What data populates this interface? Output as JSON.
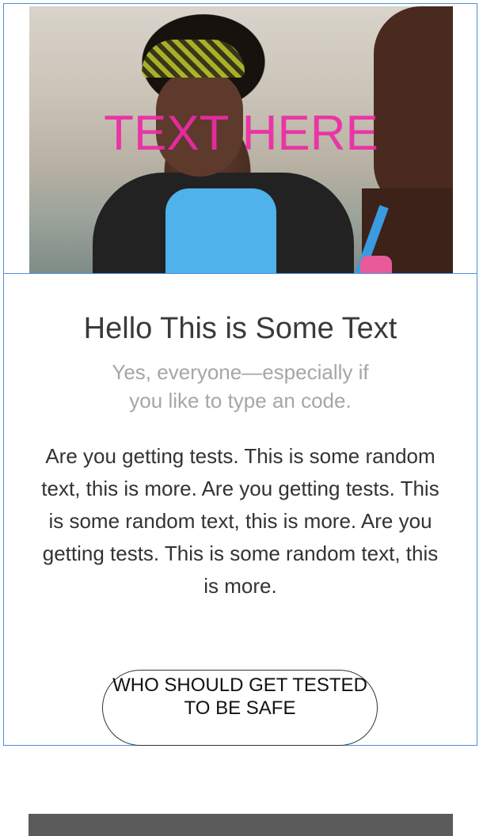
{
  "hero": {
    "overlay_text": "TEXT HERE",
    "overlay_color": "#ee2aa6"
  },
  "content": {
    "headline": "Hello This is Some Text",
    "subtitle": "Yes, everyone—especially if you like to type an code.",
    "body": "Are you getting tests. This is some random text, this is more. Are you getting tests. This is some random text, this is more. Are you getting tests. This is some random text, this is more."
  },
  "cta": {
    "label": "WHO SHOULD GET TESTED TO BE SAFE"
  },
  "colors": {
    "frame_border": "#4a90e2",
    "footer_bar": "#5b5b5b"
  }
}
